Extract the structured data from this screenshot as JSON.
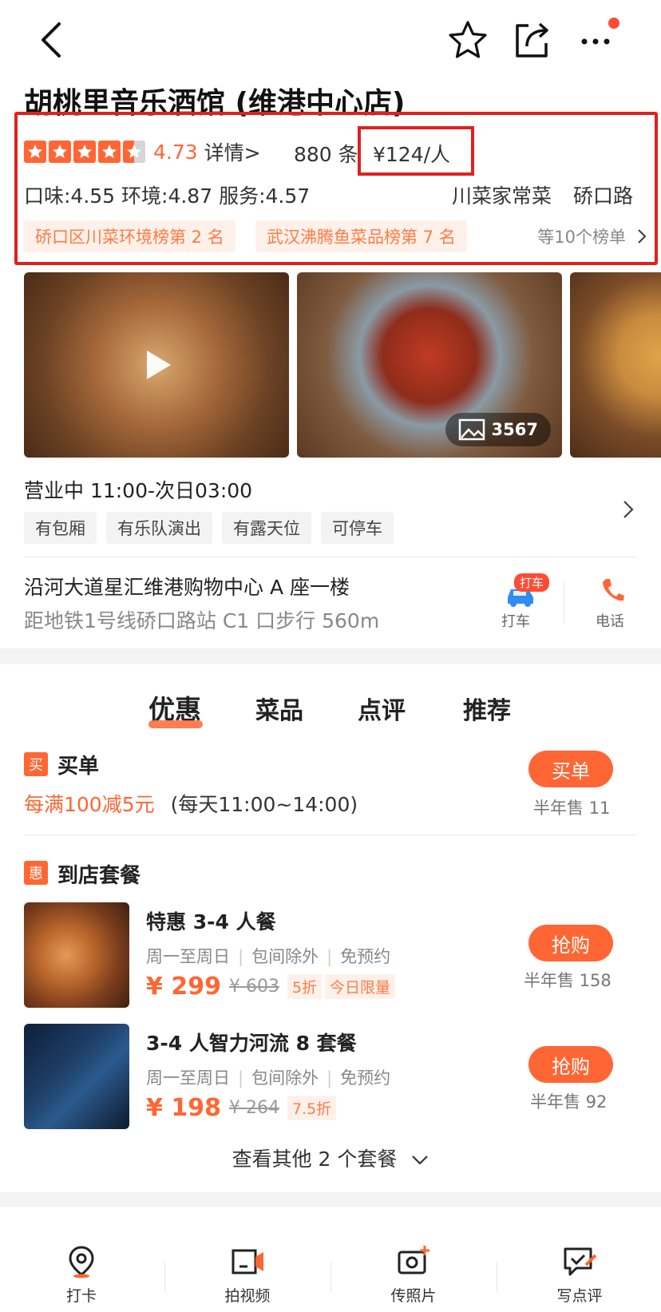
{
  "nav": {
    "back_icon": "back-icon",
    "favorite_icon": "star-icon",
    "share_icon": "share-icon",
    "more_icon": "more-icon"
  },
  "shop": {
    "name": "胡桃里音乐酒馆 (维港中心店)",
    "rating": "4.73",
    "rating_value": 4.73,
    "detail_link": "详情>",
    "review_count": "880 条",
    "price_per_person": "¥124/人",
    "scores": "口味:4.55  环境:4.87  服务:4.57",
    "cuisine": "川菜家常菜",
    "area": "硚口路",
    "rank_tags": [
      "硚口区川菜环境榜第 2 名",
      "武汉沸腾鱼菜品榜第 7 名"
    ],
    "rank_more": "等10个榜单",
    "photo_count": "3567",
    "hours": "营业中  11:00-次日03:00",
    "facility_tags": [
      "有包厢",
      "有乐队演出",
      "有露天位",
      "可停车"
    ],
    "address": "沿河大道星汇维港购物中心 A 座一楼",
    "subway": "距地铁1号线硚口路站 C1 口步行 560m",
    "taxi_badge": "打车",
    "taxi_label": "打车",
    "phone_label": "电话"
  },
  "tabs": [
    "优惠",
    "菜品",
    "点评",
    "推荐"
  ],
  "pay": {
    "icon_text": "买",
    "title": "买单",
    "promo": "每满100减5元",
    "promo_time": "(每天11:00~14:00)",
    "button": "买单",
    "sold": "半年售 11"
  },
  "packages": {
    "icon_text": "惠",
    "title": "到店套餐",
    "items": [
      {
        "title": "特惠 3-4 人餐",
        "conds": [
          "周一至周日",
          "包间除外",
          "免预约"
        ],
        "price": "¥ 299",
        "orig": "¥ 603",
        "discount": "5折",
        "limit": "今日限量",
        "button": "抢购",
        "sold": "半年售 158"
      },
      {
        "title": "3-4 人智力河流 8 套餐",
        "conds": [
          "周一至周日",
          "包间除外",
          "免预约"
        ],
        "price": "¥ 198",
        "orig": "¥ 264",
        "discount": "7.5折",
        "limit": "",
        "button": "抢购",
        "sold": "半年售 92"
      }
    ],
    "more": "查看其他 2 个套餐"
  },
  "bottom_bar": [
    {
      "label": "打卡",
      "icon": "location-pin-icon"
    },
    {
      "label": "拍视频",
      "icon": "video-camera-icon"
    },
    {
      "label": "传照片",
      "icon": "photo-upload-icon"
    },
    {
      "label": "写点评",
      "icon": "write-review-icon"
    }
  ],
  "colors": {
    "accent": "#ff6633",
    "highlight_box": "#e02020",
    "tag_bg": "#fff1ea"
  }
}
